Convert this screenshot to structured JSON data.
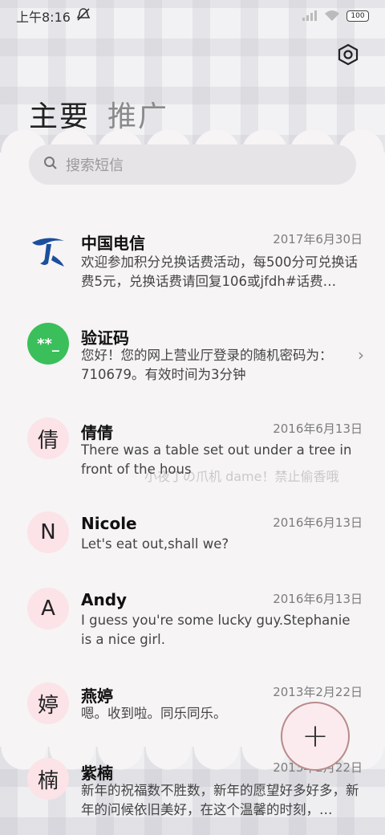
{
  "status_bar": {
    "time": "上午8:16",
    "battery": "100"
  },
  "tabs": [
    {
      "label": "主要",
      "active": true
    },
    {
      "label": "推广",
      "active": false
    }
  ],
  "search": {
    "placeholder": "搜索短信"
  },
  "conversations": [
    {
      "avatar_type": "logo",
      "avatar_text": "",
      "name": "中国电信",
      "date": "2017年6月30日",
      "message": "欢迎参加积分兑换话费活动，每500分可兑换话费5元，兑换话费请回复106或jfdh#话费…"
    },
    {
      "avatar_type": "green",
      "avatar_text": "**_",
      "name": "验证码",
      "date": "",
      "message": "您好！您的网上营业厅登录的随机密码为：710679。有效时间为3分钟"
    },
    {
      "avatar_type": "pink",
      "avatar_text": "倩",
      "name": "倩倩",
      "date": "2016年6月13日",
      "message": "There was a table set out under a tree in front of the hous"
    },
    {
      "avatar_type": "pink",
      "avatar_text": "N",
      "name": "Nicole",
      "date": "2016年6月13日",
      "message": "Let's eat out,shall we?"
    },
    {
      "avatar_type": "pink",
      "avatar_text": "A",
      "name": "Andy",
      "date": "2016年6月13日",
      "message": "I guess you're some lucky guy.Stephanie is a nice girl."
    },
    {
      "avatar_type": "pink",
      "avatar_text": "婷",
      "name": "燕婷",
      "date": "2013年2月22日",
      "message": "嗯。收到啦。同乐同乐。"
    },
    {
      "avatar_type": "pink",
      "avatar_text": "楠",
      "name": "紫楠",
      "date": "2013年2月22日",
      "message": "新年的祝福数不胜数，新年的愿望好多好多，新年的问候依旧美好，在这个温馨的时刻，…"
    }
  ],
  "watermark": "小夜丁の爪机 dame！禁止偷香哦",
  "fab": {
    "label": "+"
  },
  "colors": {
    "accent_green": "#3bbf5a",
    "avatar_pink": "#fbe3e8",
    "telecom_blue": "#1b4f9c"
  },
  "icons": [
    "mute-icon",
    "signal-icon",
    "wifi-icon",
    "battery-icon",
    "settings-icon",
    "search-icon",
    "chevron-right-icon",
    "plus-icon"
  ]
}
